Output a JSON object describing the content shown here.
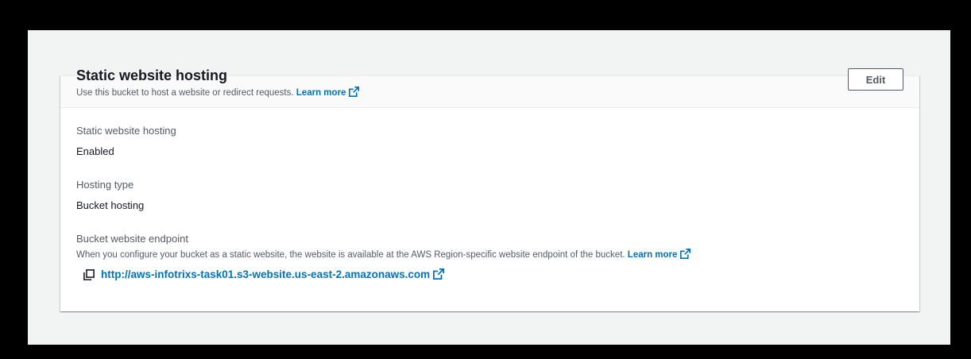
{
  "panel": {
    "title": "Static website hosting",
    "description": "Use this bucket to host a website or redirect requests.",
    "learn_more": "Learn more",
    "edit_label": "Edit"
  },
  "fields": {
    "hosting": {
      "label": "Static website hosting",
      "value": "Enabled"
    },
    "hosting_type": {
      "label": "Hosting type",
      "value": "Bucket hosting"
    },
    "endpoint": {
      "label": "Bucket website endpoint",
      "description": "When you configure your bucket as a static website, the website is available at the AWS Region-specific website endpoint of the bucket.",
      "learn_more": "Learn more",
      "url": "http://aws-infotrixs-task01.s3-website.us-east-2.amazonaws.com"
    }
  },
  "icons": {
    "external_link": "external-link-icon",
    "copy": "copy-icon"
  },
  "colors": {
    "link": "#0073bb",
    "title": "#16191f",
    "secondary_text": "#545b64"
  }
}
